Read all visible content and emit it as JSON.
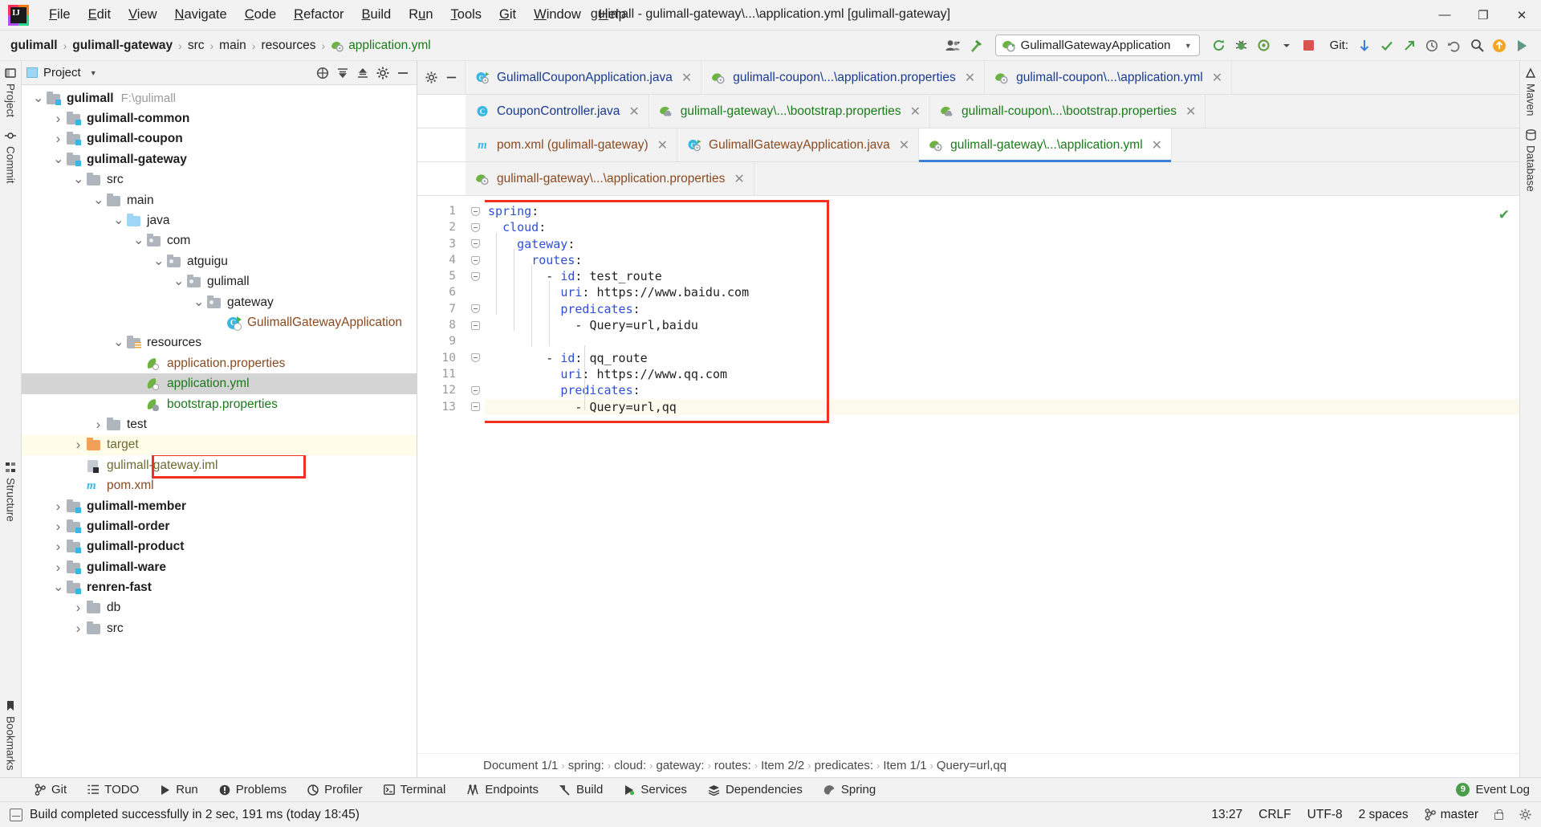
{
  "window": {
    "title": "gulimall - gulimall-gateway\\...\\application.yml [gulimall-gateway]",
    "minimize": "—",
    "maximize": "❐",
    "close": "✕"
  },
  "menubar": [
    {
      "label": "File",
      "accel": "F"
    },
    {
      "label": "Edit",
      "accel": "E"
    },
    {
      "label": "View",
      "accel": "V"
    },
    {
      "label": "Navigate",
      "accel": "N"
    },
    {
      "label": "Code",
      "accel": "C"
    },
    {
      "label": "Refactor",
      "accel": "R"
    },
    {
      "label": "Build",
      "accel": "B"
    },
    {
      "label": "Run",
      "accel": "u"
    },
    {
      "label": "Tools",
      "accel": "T"
    },
    {
      "label": "Git",
      "accel": "G"
    },
    {
      "label": "Window",
      "accel": "W"
    },
    {
      "label": "Help",
      "accel": "H"
    }
  ],
  "navbar": {
    "crumbs": [
      "gulimall",
      "gulimall-gateway",
      "src",
      "main",
      "resources",
      "application.yml"
    ],
    "separator": "›",
    "run_config": "GulimallGatewayApplication",
    "git_label": "Git:",
    "icons": [
      "user-group-icon",
      "hammer-icon",
      "rerun-icon",
      "debug-icon",
      "coverage-icon",
      "profile-icon",
      "stop-icon",
      "git-update-icon",
      "git-commit-icon",
      "git-push-icon",
      "history-icon",
      "undo-icon",
      "search-icon",
      "upload-icon",
      "run-icon"
    ]
  },
  "left_rail": [
    {
      "label": "Project",
      "icon": "project-icon"
    },
    {
      "label": "Commit",
      "icon": "commit-icon"
    },
    {
      "label": "Structure",
      "icon": "structure-icon"
    },
    {
      "label": "Bookmarks",
      "icon": "bookmarks-icon"
    }
  ],
  "right_rail": [
    {
      "label": "Maven",
      "icon": "maven-icon"
    },
    {
      "label": "Database",
      "icon": "database-icon"
    }
  ],
  "project_panel": {
    "title": "Project",
    "header_icons": [
      "scope-icon",
      "collapse-all-icon",
      "expand-all-icon",
      "settings-icon",
      "hide-icon"
    ],
    "tree": [
      {
        "indent": 0,
        "arrow": "v",
        "icon": "module-folder",
        "label": "gulimall",
        "bold": true,
        "path": "F:\\gulimall",
        "color": "default"
      },
      {
        "indent": 1,
        "arrow": ">",
        "icon": "module-folder",
        "label": "gulimall-common",
        "bold": true,
        "color": "default"
      },
      {
        "indent": 1,
        "arrow": ">",
        "icon": "module-folder",
        "label": "gulimall-coupon",
        "bold": true,
        "color": "default"
      },
      {
        "indent": 1,
        "arrow": "v",
        "icon": "module-folder",
        "label": "gulimall-gateway",
        "bold": true,
        "color": "default"
      },
      {
        "indent": 2,
        "arrow": "v",
        "icon": "folder",
        "label": "src",
        "color": "default"
      },
      {
        "indent": 3,
        "arrow": "v",
        "icon": "folder",
        "label": "main",
        "color": "default"
      },
      {
        "indent": 4,
        "arrow": "v",
        "icon": "source-folder",
        "label": "java",
        "color": "default"
      },
      {
        "indent": 5,
        "arrow": "v",
        "icon": "package-folder",
        "label": "com",
        "color": "default"
      },
      {
        "indent": 6,
        "arrow": "v",
        "icon": "package-folder",
        "label": "atguigu",
        "color": "default"
      },
      {
        "indent": 7,
        "arrow": "v",
        "icon": "package-folder",
        "label": "gulimall",
        "color": "default"
      },
      {
        "indent": 8,
        "arrow": "v",
        "icon": "package-folder",
        "label": "gateway",
        "color": "default"
      },
      {
        "indent": 9,
        "arrow": "",
        "icon": "spring-class",
        "label": "GulimallGatewayApplication",
        "color": "brown"
      },
      {
        "indent": 4,
        "arrow": "v",
        "icon": "resource-folder",
        "label": "resources",
        "color": "default"
      },
      {
        "indent": 5,
        "arrow": "",
        "icon": "spring-file",
        "label": "application.properties",
        "color": "brown"
      },
      {
        "indent": 5,
        "arrow": "",
        "icon": "spring-file",
        "label": "application.yml",
        "color": "green",
        "selected": true,
        "annotated": true
      },
      {
        "indent": 5,
        "arrow": "",
        "icon": "spring-cloud-file",
        "label": "bootstrap.properties",
        "color": "green"
      },
      {
        "indent": 3,
        "arrow": ">",
        "icon": "folder",
        "label": "test",
        "color": "default"
      },
      {
        "indent": 2,
        "arrow": ">",
        "icon": "target-folder",
        "label": "target",
        "color": "olive",
        "highlight": true
      },
      {
        "indent": 2,
        "arrow": "",
        "icon": "iml-file",
        "label": "gulimall-gateway.iml",
        "color": "olive"
      },
      {
        "indent": 2,
        "arrow": "",
        "icon": "maven-file",
        "label": "pom.xml",
        "color": "brown"
      },
      {
        "indent": 1,
        "arrow": ">",
        "icon": "module-folder",
        "label": "gulimall-member",
        "bold": true,
        "color": "default"
      },
      {
        "indent": 1,
        "arrow": ">",
        "icon": "module-folder",
        "label": "gulimall-order",
        "bold": true,
        "color": "default"
      },
      {
        "indent": 1,
        "arrow": ">",
        "icon": "module-folder",
        "label": "gulimall-product",
        "bold": true,
        "color": "default"
      },
      {
        "indent": 1,
        "arrow": ">",
        "icon": "module-folder",
        "label": "gulimall-ware",
        "bold": true,
        "color": "default"
      },
      {
        "indent": 1,
        "arrow": "v",
        "icon": "module-folder",
        "label": "renren-fast",
        "bold": true,
        "color": "default"
      },
      {
        "indent": 2,
        "arrow": ">",
        "icon": "folder",
        "label": "db",
        "color": "default"
      },
      {
        "indent": 2,
        "arrow": ">",
        "icon": "folder",
        "label": "src",
        "color": "default"
      }
    ]
  },
  "editor": {
    "tab_rows": [
      [
        {
          "label": "GulimallCouponApplication.java",
          "icon": "spring-class",
          "color": "blue",
          "active": false
        },
        {
          "label": "gulimall-coupon\\...\\application.properties",
          "icon": "spring-file",
          "color": "blue",
          "active": false
        },
        {
          "label": "gulimall-coupon\\...\\application.yml",
          "icon": "spring-file",
          "color": "blue",
          "active": false
        }
      ],
      [
        {
          "label": "CouponController.java",
          "icon": "java-class",
          "color": "blue",
          "active": false
        },
        {
          "label": "gulimall-gateway\\...\\bootstrap.properties",
          "icon": "spring-cloud-file",
          "color": "green",
          "active": false
        },
        {
          "label": "gulimall-coupon\\...\\bootstrap.properties",
          "icon": "spring-cloud-file",
          "color": "green",
          "active": false
        }
      ],
      [
        {
          "label": "pom.xml (gulimall-gateway)",
          "icon": "maven-file",
          "color": "brown",
          "active": false
        },
        {
          "label": "GulimallGatewayApplication.java",
          "icon": "spring-class",
          "color": "brown",
          "active": false
        },
        {
          "label": "gulimall-gateway\\...\\application.yml",
          "icon": "spring-file",
          "color": "green",
          "active": true
        }
      ],
      [
        {
          "label": "gulimall-gateway\\...\\application.properties",
          "icon": "spring-file",
          "color": "brown",
          "active": false
        }
      ]
    ],
    "close_glyph": "✕",
    "line_numbers": [
      1,
      2,
      3,
      4,
      5,
      6,
      7,
      8,
      9,
      10,
      11,
      12,
      13
    ],
    "code_lines": [
      {
        "n": 1,
        "indent": 0,
        "key": "spring",
        "colon": ":",
        "value": "",
        "fold": "tri"
      },
      {
        "n": 2,
        "indent": 1,
        "key": "cloud",
        "colon": ":",
        "value": "",
        "fold": "tri"
      },
      {
        "n": 3,
        "indent": 2,
        "key": "gateway",
        "colon": ":",
        "value": "",
        "fold": "tri"
      },
      {
        "n": 4,
        "indent": 3,
        "key": "routes",
        "colon": ":",
        "value": "",
        "fold": "tri"
      },
      {
        "n": 5,
        "indent": 4,
        "dash": "- ",
        "key": "id",
        "colon": ": ",
        "value": "test_route",
        "fold": "tri"
      },
      {
        "n": 6,
        "indent": 5,
        "key": "uri",
        "colon": ": ",
        "value": "https://www.baidu.com",
        "fold": ""
      },
      {
        "n": 7,
        "indent": 5,
        "key": "predicates",
        "colon": ":",
        "value": "",
        "fold": "tri"
      },
      {
        "n": 8,
        "indent": 6,
        "dash": "- ",
        "key": "",
        "colon": "",
        "value": "Query=url,baidu",
        "fold": "end"
      },
      {
        "n": 9,
        "indent": 0,
        "key": "",
        "colon": "",
        "value": "",
        "fold": ""
      },
      {
        "n": 10,
        "indent": 4,
        "dash": "- ",
        "key": "id",
        "colon": ": ",
        "value": "qq_route",
        "fold": "tri"
      },
      {
        "n": 11,
        "indent": 5,
        "key": "uri",
        "colon": ": ",
        "value": "https://www.qq.com",
        "fold": ""
      },
      {
        "n": 12,
        "indent": 5,
        "key": "predicates",
        "colon": ":",
        "value": "",
        "fold": "tri"
      },
      {
        "n": 13,
        "indent": 6,
        "dash": "- ",
        "key": "",
        "colon": "",
        "value": "Query=url,qq",
        "fold": "end",
        "current": true
      }
    ],
    "inspection_status": "✔",
    "breadcrumb": [
      "Document 1/1",
      "spring:",
      "cloud:",
      "gateway:",
      "routes:",
      "Item 2/2",
      "predicates:",
      "Item 1/1",
      "Query=url,qq"
    ],
    "breadcrumb_sep": "›"
  },
  "bottom_toolwindows": [
    {
      "label": "Git",
      "icon": "git-branch-icon"
    },
    {
      "label": "TODO",
      "icon": "todo-list-icon"
    },
    {
      "label": "Run",
      "icon": "run-triangle-icon"
    },
    {
      "label": "Problems",
      "icon": "problems-icon"
    },
    {
      "label": "Profiler",
      "icon": "profiler-icon"
    },
    {
      "label": "Terminal",
      "icon": "terminal-icon"
    },
    {
      "label": "Endpoints",
      "icon": "endpoints-icon"
    },
    {
      "label": "Build",
      "icon": "build-hammer-icon"
    },
    {
      "label": "Services",
      "icon": "services-icon"
    },
    {
      "label": "Dependencies",
      "icon": "dependencies-icon"
    },
    {
      "label": "Spring",
      "icon": "spring-leaf-icon"
    }
  ],
  "event_log": {
    "label": "Event Log",
    "badge": "9"
  },
  "statusbar": {
    "message": "Build completed successfully in 2 sec, 191 ms (today 18:45)",
    "position": "13:27",
    "line_separator": "CRLF",
    "encoding": "UTF-8",
    "indent": "2 spaces",
    "branch": "master",
    "branch_icon": "git-branch-icon",
    "lock_icon": "lock-icon",
    "settings_icon": "gear-icon"
  }
}
